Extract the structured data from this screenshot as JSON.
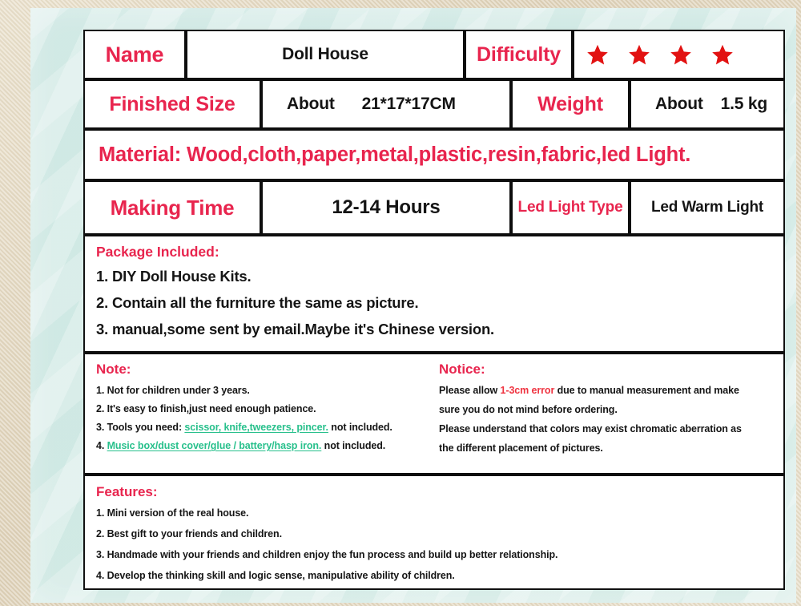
{
  "spec": {
    "name_label": "Name",
    "name_value": "Doll House",
    "difficulty_label": "Difficulty",
    "difficulty_stars": 4,
    "finished_size_label": "Finished Size",
    "finished_size_about": "About",
    "finished_size_value": "21*17*17CM",
    "weight_label": "Weight",
    "weight_about": "About",
    "weight_value": "1.5 kg",
    "material_line": "Material: Wood,cloth,paper,metal,plastic,resin,fabric,led Light.",
    "making_time_label": "Making Time",
    "making_time_value": "12-14 Hours",
    "led_light_type_label": "Led Light Type",
    "led_light_type_value": "Led Warm Light"
  },
  "package": {
    "title": "Package Included:",
    "items": [
      "1. DIY Doll House Kits.",
      "2. Contain all the furniture the same as picture.",
      "3. manual,some sent by email.Maybe it's Chinese version."
    ]
  },
  "note": {
    "title": "Note:",
    "item1": "1. Not for children under 3 years.",
    "item2": "2. It's easy to finish,just need enough patience.",
    "item3_prefix": "3. Tools you need: ",
    "item3_green": "scissor, knife,tweezers, pincer.",
    "item3_suffix": " not included.",
    "item4_prefix": "4. ",
    "item4_green": "Music box/dust cover/glue / battery/hasp iron.",
    "item4_suffix": " not included."
  },
  "notice": {
    "title": "Notice:",
    "line1_prefix": "Please allow ",
    "line1_red": "1-3cm error",
    "line1_suffix": " due to manual measurement and make",
    "line2": "sure you do not mind before ordering.",
    "line3": "Please understand that colors may exist chromatic aberration as",
    "line4": "the different placement of pictures."
  },
  "features": {
    "title": "Features:",
    "items": [
      "1. Mini version of the real house.",
      "2. Best gift to your friends and children.",
      "3. Handmade with your friends and children enjoy the fun process and build up better relationship.",
      "4. Develop the thinking skill and logic sense, manipulative ability of children."
    ]
  },
  "colors": {
    "heading_pink": "#e8254e",
    "star_red": "#e21212",
    "green_accent": "#28c08c",
    "notice_red": "#ef3340",
    "mint_background": "#cfe8e4",
    "frame_beige": "#e3d9c4"
  }
}
